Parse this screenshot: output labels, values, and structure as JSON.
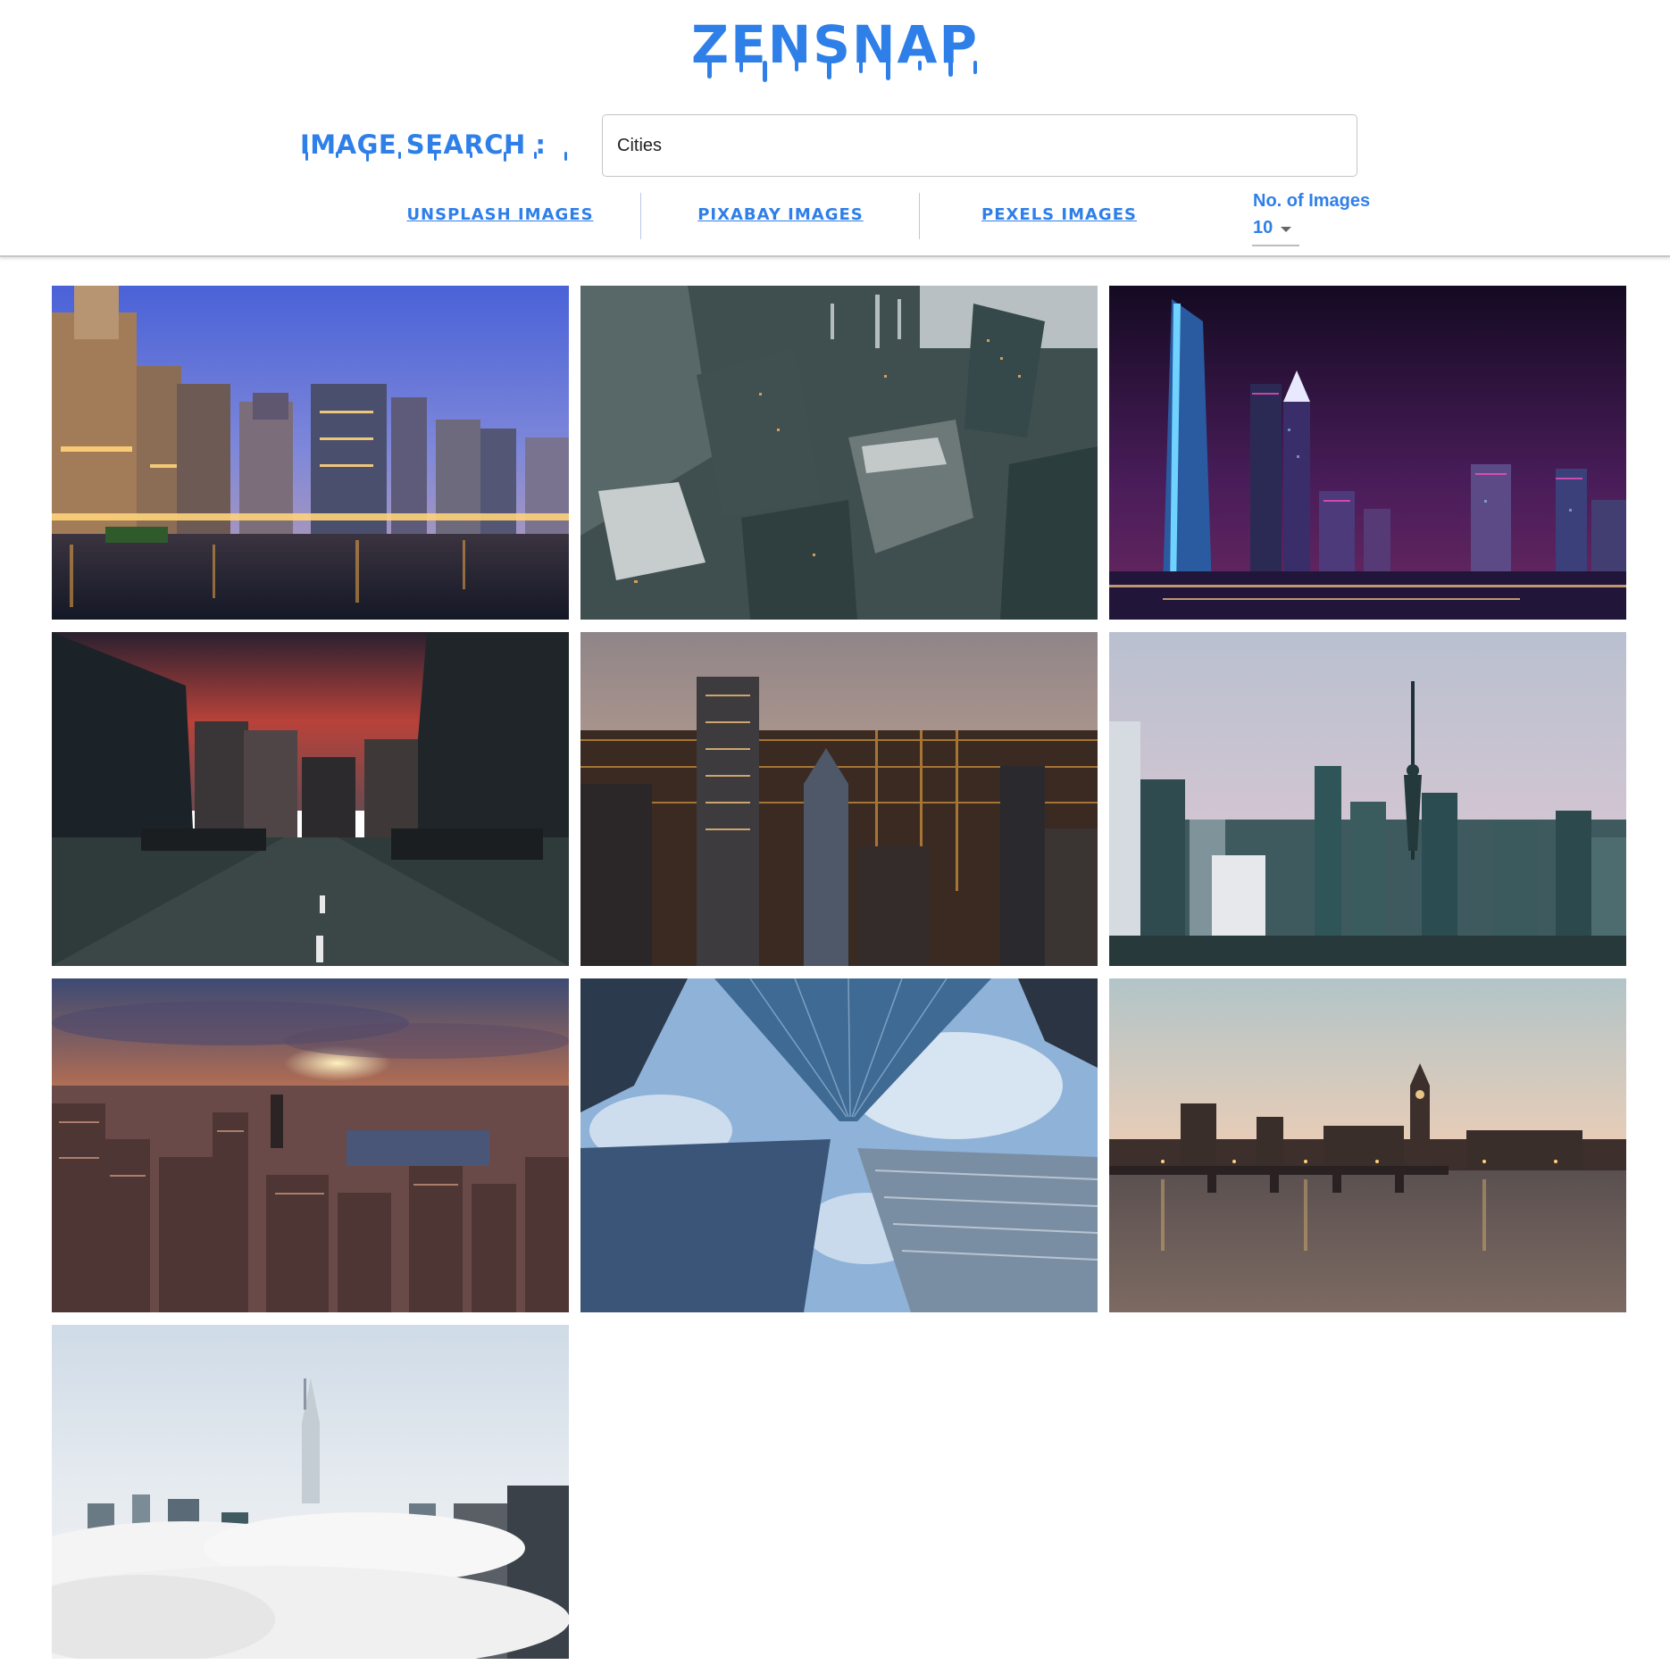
{
  "app": {
    "logo_text": "ZENSNAP",
    "brand_color": "#2f7fe9"
  },
  "search": {
    "label": "IMAGE SEARCH :",
    "value": "Cities"
  },
  "sources": [
    {
      "label": "UNSPLASH IMAGES"
    },
    {
      "label": "PIXABAY IMAGES"
    },
    {
      "label": "PEXELS IMAGES"
    }
  ],
  "count": {
    "label": "No. of Images",
    "value": "10"
  },
  "gallery": {
    "images": [
      {
        "subject": "river-skyline-dusk"
      },
      {
        "subject": "aerial-skyscrapers"
      },
      {
        "subject": "night-skyline-purple"
      },
      {
        "subject": "street-sunset"
      },
      {
        "subject": "city-lights-aerial"
      },
      {
        "subject": "skyline-tower"
      },
      {
        "subject": "sunset-over-city"
      },
      {
        "subject": "looking-up-skyscrapers"
      },
      {
        "subject": "parliament-bridge"
      },
      {
        "subject": "city-in-clouds"
      }
    ]
  }
}
